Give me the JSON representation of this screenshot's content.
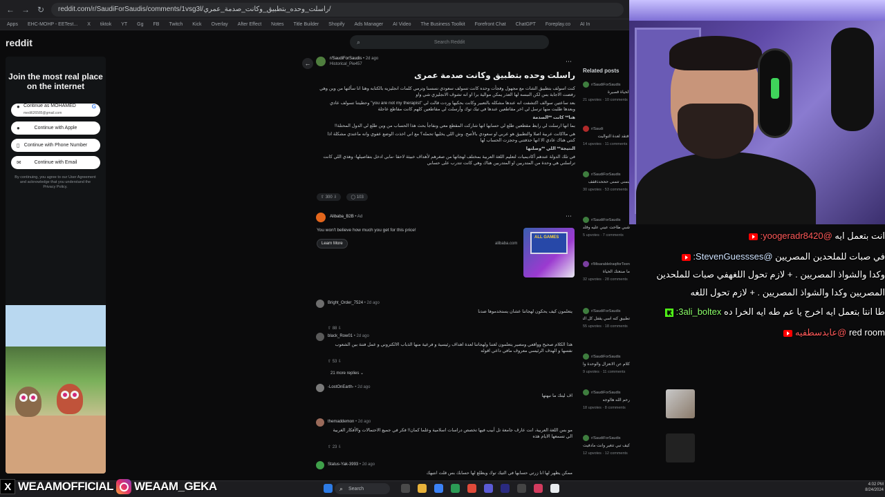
{
  "browser": {
    "url": "reddit.com/r/SaudiForSaudis/comments/1vsg3l/راسلت_وحده_بتطبيق_وكانت_صدمة_عمري/",
    "bookmarks": [
      "Apps",
      "EHC-MOHP - EETest...",
      "X",
      "tiktok",
      "YT",
      "Gg",
      "FB",
      "Twitch",
      "Kick",
      "Overlay",
      "After Effect",
      "Notes",
      "Title Builder",
      "Shopify",
      "Ads Manager",
      "AI Video",
      "The Business Toolkit",
      "Forefront Chat",
      "ChatGPT",
      "Foreplay.co",
      "AI In"
    ]
  },
  "reddit": {
    "logo": "reddit",
    "search_placeholder": "Search Reddit",
    "login": {
      "title": "Join the most real place on the internet",
      "google_name": "Continue as MOHAMED",
      "google_email": "medi626585@gmail.com",
      "apple": "Continue with Apple",
      "phone": "Continue with Phone Number",
      "email": "Continue with Email",
      "terms": "By continuing, you agree to our User Agreement and acknowledge that you understand the Privacy Policy."
    },
    "post": {
      "subreddit": "r/SaudiForSaudis",
      "age": "• 2d ago",
      "author": "Historical_Pie457",
      "title": "راسلت وحده بتطبيق وكانت صدمة عمرى",
      "body": [
        "كنت اسولف بتطبيق الشات مع مجهول وفجأت وحده كانت تسولف سعودي نسسنا وترمي كلمات انجليزيه بالكتابه وهنا انا سألتها من وين وهي رفضت الاجابة بس لكن النبسه لها العذر يمكن موالية برا او انه تشوف الانجليزي شي واو",
        "بعد ساعتين سوالف اكتشفت انه عندها مشكله بالتعبير وكانت بحكيها وردت قالت لي \"you are not my therapist\" وحطيتنا تسولف عادي وبعدها طلبت منها ترسل لي اخر مقاطعين عندها في تيك توك وأرسلت لي مقاطعين كلهم كانت مقاطع عاجلة",
        "هنا** كانت **الصدمة",
        "بما انها ارسلت لي رابط مقطعين طلع لي حسابها انها شاركت المقطع معي ونفاجأ بحث هذا الحساب من وين طلع لي الدول المحتلة!!",
        "هي مااكانت عربية اصلا والتطبيق هو عربي او سعودي بالأصح. وش اللي يخليها تحمله؟ مع اني اخذت الوضع عفوي وانه ماعندي مشكلة اذا كنتي هناك عادي الا انها حذفتني وحجزت الحساب لها",
        "النتيجة** اللي **وصلتها",
        "في تلك الدولة عندهم أكاديميات لتعليم اللغة العربية بمختلف لهجاتها من صغرهم لأهداف خبيثة لاحقا -مابي ادخل بتفاصيلها- وهذي اللي كانت تراسلني هي وحدة من المتدربين او المتدربين هناك وهي كانت تتدرب على حسابي"
      ],
      "upvotes": "300",
      "comments": "103"
    },
    "ad": {
      "advertiser": "Alibaba_B2B",
      "tag": "• Ad",
      "text": "You won't believe how much you get for this price!",
      "cta": "Learn More",
      "domain": "alibaba.com",
      "image_label": "ALL GAMES"
    },
    "comments": [
      {
        "user": "Bright_Order_7524",
        "age": "• 2d ago",
        "text": "يتعلمون كيف يحكون لهجاتنا عشان يستخدموها ضدنا",
        "votes": "88"
      },
      {
        "user": "black_Row01",
        "age": "• 2d ago",
        "text": "هذا الكلام صحيح وواقعي ومصير يتعلمون لغتنا ولهجاتنا لعدة اهداف رئيسية و فرعية منها الذباب الالكتروني و عمل فتنة بين الشعوب نفسها و الهدف الرئيسي معروف مافي داعي اقوله",
        "votes": "53"
      },
      {
        "user": "-LostOnEarth-",
        "age": "• 2d ago",
        "text": "اف ليتك ما نبهتها",
        "votes": ""
      },
      {
        "user": "themaddemon",
        "age": "• 2d ago",
        "text": "مو بس اللغة العربية، انت عارف جامعة تل أبيب فيها تخصص دراسات اسلامية وعلما كمان!! فكر في جميع الاحتمالات والأفكار الغربية الي تسمعها الايام هذه",
        "votes": "23"
      },
      {
        "user": "Status-Yak-3993",
        "age": "• 2d ago",
        "text": "ممكن يظهر لها انا زرتي حسابها في التيك توك ويطلع لها حسابك بس قلت انتبهك",
        "votes": ""
      }
    ],
    "more_replies": "21 more replies",
    "related": {
      "title": "Related posts",
      "items": [
        {
          "sub": "r/SaudiForSaudis",
          "text": "الحياة قصيرة",
          "meta": "21 upvotes · 10 comments"
        },
        {
          "sub": "r/Saudi",
          "text": "افتقد لعدة التواليت",
          "meta": "14 upvotes · 11 comments"
        },
        {
          "sub": "r/SaudiForSaudis",
          "text": "يتمنى تتمنى حححدذقفف",
          "meta": "30 upvotes · 53 comments"
        },
        {
          "sub": "r/SaudiForSaudis",
          "text": "شبي طاحت عيني عليه وقلت افيدكم",
          "meta": "5 upvotes · 7 comments"
        },
        {
          "sub": "r/MisarablelraqiforTeen",
          "text": "ما صنعتك الحياة",
          "meta": "32 upvotes · 28 comments"
        },
        {
          "sub": "r/SaudiForSaudis",
          "text": "تطبيق كنه اسي يقفل كل التطبيقات",
          "meta": "55 upvotes · 18 comments"
        },
        {
          "sub": "r/SaudiForSaudis",
          "text": "كلام عن الانعزال والوحدة والعلاقات",
          "meta": "9 upvotes · 11 comments"
        },
        {
          "sub": "r/SaudiForSaudis",
          "text": "رحم الله هالوجه",
          "meta": "18 upvotes · 8 comments"
        },
        {
          "sub": "r/SaudiForSaudis",
          "text": "كيف تبي تتغير وانت مادفيت باب الوتر",
          "meta": "12 upvotes · 12 comments"
        }
      ]
    }
  },
  "chat": [
    {
      "platform": "youtube",
      "user": "@yoogeradr8420:",
      "message": "انت بتعمل ايه"
    },
    {
      "platform": "youtube",
      "user": "@StevenGuessses:",
      "message": "في صبات للملحدين المصريين"
    },
    {
      "platform": "youtube",
      "user": "",
      "message": "وكدا والشواذ المصريين . + لازم تحول اللغهفي صبات للملحدين"
    },
    {
      "platform": "youtube",
      "user": "",
      "message": "المصريين وكدا والشواذ المصريين . + لازم تحول اللغه"
    },
    {
      "platform": "kick",
      "user": "3ali_boltex:",
      "message": "طا انتا بتعمل ايه اخرج يا عم طه ايه الخرا ده"
    },
    {
      "platform": "youtube",
      "user": "@عابدسطفيه",
      "message": "red room"
    }
  ],
  "social": {
    "x": "WEAAMOFFICIAL",
    "instagram": "WEAAM_GEKA"
  },
  "taskbar": {
    "search": "Search",
    "time": "4:02 PM",
    "date": "8/24/2024"
  }
}
